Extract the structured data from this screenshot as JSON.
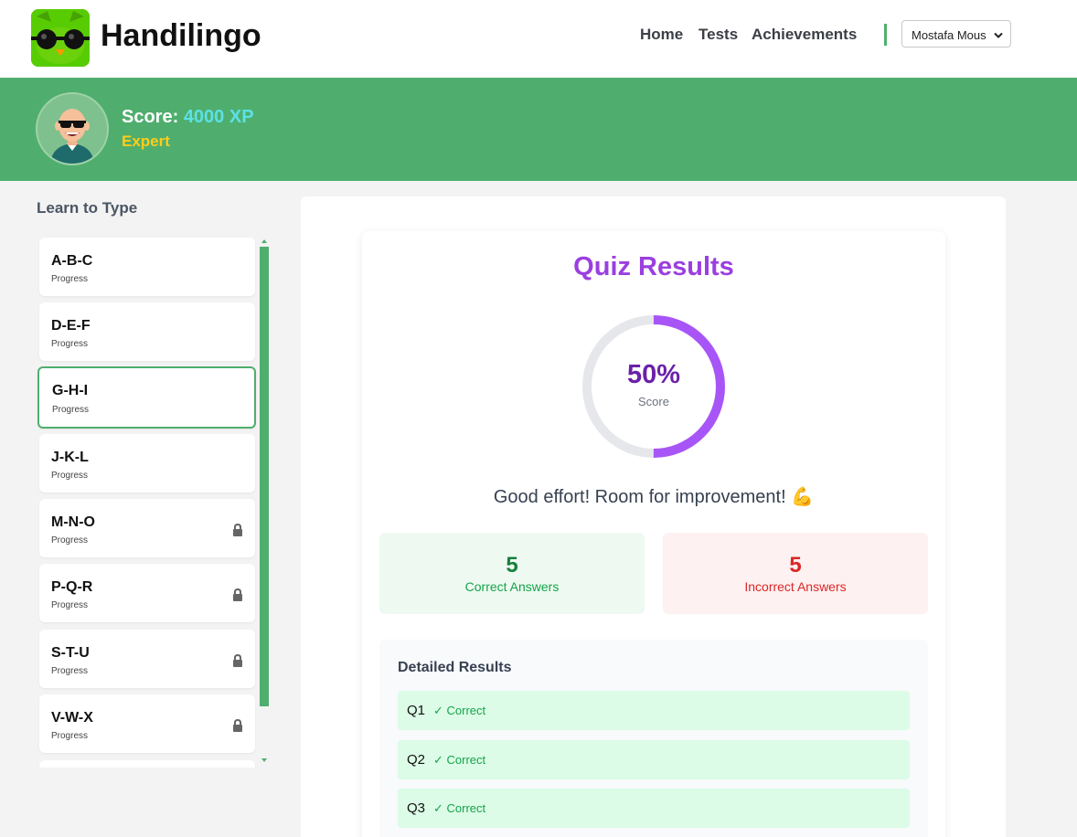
{
  "header": {
    "brand": "Handilingo",
    "nav": [
      {
        "label": "Home"
      },
      {
        "label": "Tests"
      },
      {
        "label": "Achievements"
      }
    ],
    "user_select_value": "Mostafa Mous"
  },
  "banner": {
    "score_label": "Score:",
    "score_value": "4000 XP",
    "rank": "Expert"
  },
  "sidebar": {
    "title": "Learn to Type",
    "lessons": [
      {
        "name": "A-B-C",
        "sub": "Progress",
        "locked": false
      },
      {
        "name": "D-E-F",
        "sub": "Progress",
        "locked": false
      },
      {
        "name": "G-H-I",
        "sub": "Progress",
        "locked": false,
        "active": true
      },
      {
        "name": "J-K-L",
        "sub": "Progress",
        "locked": false
      },
      {
        "name": "M-N-O",
        "sub": "Progress",
        "locked": true
      },
      {
        "name": "P-Q-R",
        "sub": "Progress",
        "locked": true
      },
      {
        "name": "S-T-U",
        "sub": "Progress",
        "locked": true
      },
      {
        "name": "V-W-X",
        "sub": "Progress",
        "locked": true
      }
    ]
  },
  "results": {
    "title": "Quiz Results",
    "score_percent": "50%",
    "score_fraction": 0.5,
    "score_label": "Score",
    "feedback": "Good effort! Room for improvement! 💪",
    "correct_count": "5",
    "correct_label": "Correct Answers",
    "incorrect_count": "5",
    "incorrect_label": "Incorrect Answers",
    "details_title": "Detailed Results",
    "rows": [
      {
        "q": "Q1",
        "result": "✓ Correct"
      },
      {
        "q": "Q2",
        "result": "✓ Correct"
      },
      {
        "q": "Q3",
        "result": "✓ Correct"
      }
    ]
  },
  "colors": {
    "brand_green": "#4fae6e",
    "accent_purple": "#a855f7",
    "correct_green": "#16a34a",
    "incorrect_red": "#dc2626"
  }
}
